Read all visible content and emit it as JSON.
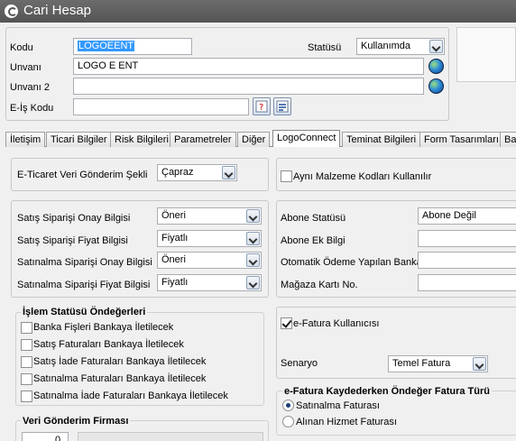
{
  "window": {
    "title": "Cari Hesap"
  },
  "header": {
    "kodu_label": "Kodu",
    "kodu_value": "LOGOEENT",
    "unvani_label": "Unvanı",
    "unvani_value": "LOGO E ENT",
    "unvani2_label": "Unvanı 2",
    "unvani2_value": "",
    "eis_label": "E-İş Kodu",
    "eis_value": "",
    "statusu_label": "Statüsü",
    "statusu_value": "Kullanımda"
  },
  "tabs": [
    {
      "label": "İletişim"
    },
    {
      "label": "Ticari Bilgiler"
    },
    {
      "label": "Risk Bilgileri"
    },
    {
      "label": "Parametreler"
    },
    {
      "label": "Diğer"
    },
    {
      "label": "LogoConnect",
      "active": true
    },
    {
      "label": "Teminat Bilgileri"
    },
    {
      "label": "Form Tasarımları"
    },
    {
      "label": "Ba"
    }
  ],
  "left": {
    "eticaret_label": "E-Ticaret Veri Gönderim Şekli",
    "eticaret_value": "Çapraz",
    "rows": [
      {
        "label": "Satış Siparişi Onay Bilgisi",
        "value": "Öneri"
      },
      {
        "label": "Satış Siparişi Fiyat Bilgisi",
        "value": "Fiyatlı"
      },
      {
        "label": "Satınalma Siparişi Onay Bilgisi",
        "value": "Öneri"
      },
      {
        "label": "Satınalma Siparişi Fiyat Bilgisi",
        "value": "Fiyatlı"
      }
    ],
    "islem_title": "İşlem Statüsü Öndeğerleri",
    "islem_items": [
      {
        "label": "Banka Fişleri Bankaya İletilecek"
      },
      {
        "label": "Satış Faturaları Bankaya İletilecek"
      },
      {
        "label": "Satış İade Faturaları Bankaya İletilecek"
      },
      {
        "label": "Satınalma Faturaları Bankaya İletilecek"
      },
      {
        "label": "Satınalma İade Faturaları Bankaya İletilecek"
      }
    ],
    "veri_title": "Veri Gönderim Firması",
    "veri_value": "0"
  },
  "right": {
    "ayni_label": "Aynı Malzeme Kodları Kullanılır",
    "abone_statusu_label": "Abone Statüsü",
    "abone_statusu_value": "Abone Değil",
    "abone_ek_label": "Abone Ek Bilgi",
    "abone_ek_value": "",
    "otomatik_label": "Otomatik Ödeme Yapılan Banka",
    "otomatik_value": "",
    "magaza_label": "Mağaza Kartı No.",
    "magaza_value": "",
    "efatura_label": "e-Fatura Kullanıcısı",
    "senaryo_label": "Senaryo",
    "senaryo_value": "Temel Fatura",
    "kaydet_title": "e-Fatura Kaydederken Öndeğer Fatura Türü",
    "radio1_label": "Satınalma Faturası",
    "radio2_label": "Alınan Hizmet Faturası"
  }
}
